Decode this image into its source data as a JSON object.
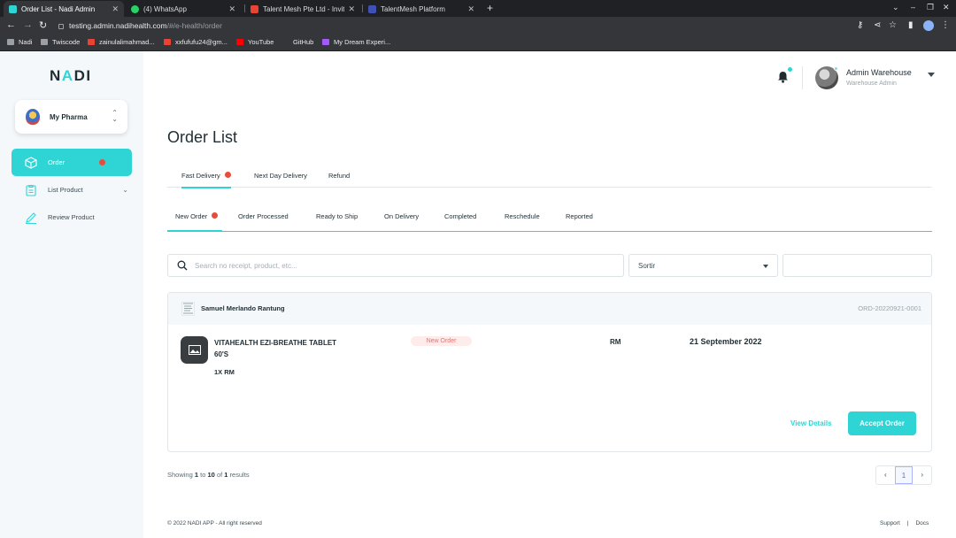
{
  "browser": {
    "tabs": [
      {
        "title": "Order List - Nadi Admin",
        "active": true
      },
      {
        "title": "(4) WhatsApp",
        "active": false
      },
      {
        "title": "Talent Mesh Pte Ltd - Invitatio",
        "active": false
      },
      {
        "title": "TalentMesh Platform",
        "active": false
      }
    ],
    "new_tab_label": "+",
    "url_host": "testing.admin.nadihealth.com",
    "url_path": "/#/e-health/order",
    "bookmarks": [
      "Nadi",
      "Twiscode",
      "zainulalimahmad...",
      "xxfufufu24@gm...",
      "YouTube",
      "GitHub",
      "My Dream Experi..."
    ]
  },
  "sidebar": {
    "logo": {
      "part1": "N",
      "accent": "A",
      "part2": "DI"
    },
    "pharmacy_name": "My Pharma",
    "nav": [
      {
        "label": "Order",
        "active": true
      },
      {
        "label": "List Product",
        "active": false
      },
      {
        "label": "Review Product",
        "active": false
      }
    ]
  },
  "header": {
    "user_name": "Admin Warehouse",
    "user_role": "Warehouse Admin"
  },
  "main": {
    "title": "Order List",
    "delivery_tabs": [
      "Fast Delivery",
      "Next Day Delivery",
      "Refund"
    ],
    "status_tabs": [
      "New Order",
      "Order Processed",
      "Ready to Ship",
      "On Delivery",
      "Completed",
      "Reschedule",
      "Reported"
    ],
    "search_placeholder": "Search no receipt, product, etc...",
    "sort_label": "Sortir",
    "order": {
      "customer": "Samuel Merlando Rantung",
      "order_id": "ORD-20220921-0001",
      "product_name": "VITAHEALTH EZI-BREATHE TABLET 60'S",
      "quantity": "1X RM",
      "status": "New Order",
      "price": "RM",
      "date": "21 September 2022",
      "view_details_label": "View Details",
      "accept_label": "Accept Order"
    },
    "pagination": {
      "showing_prefix": "Showing",
      "from": "1",
      "to_word": "to",
      "to": "10",
      "of_word": "of",
      "total": "1",
      "results_word": "results",
      "prev": "‹",
      "current": "1",
      "next": "›"
    }
  },
  "footer": {
    "copyright": "© 2022 NADI APP - All right reserved",
    "support": "Support",
    "docs": "Docs"
  },
  "colors": {
    "accent": "#2fd4d4",
    "alert": "#e74c3c",
    "sidebar_bg": "#f4f8fa"
  }
}
